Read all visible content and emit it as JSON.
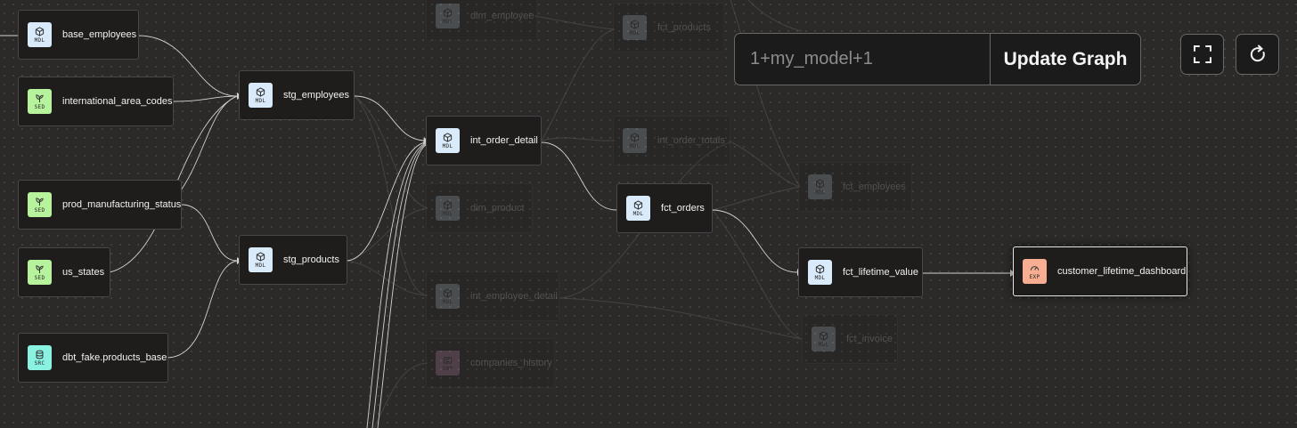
{
  "query": {
    "value": "1+my_model+1",
    "button_label": "Update Graph"
  },
  "toolbar": {
    "fullscreen_icon": "fullscreen-icon",
    "refresh_icon": "refresh-icon"
  },
  "colors": {
    "canvas": "#2b2a29",
    "node_bg": "#1e1d1c",
    "model_badge": "#d9ebfb",
    "seed_badge": "#b7f39d",
    "source_badge": "#89f2e1",
    "exposure_badge": "#f6ad92",
    "snapshot_badge": "#f19fd8"
  },
  "badge_tags": {
    "model": "MDL",
    "seed": "SED",
    "source": "SRC",
    "exposure": "EXP",
    "snapshot": "SNP"
  },
  "nodes": [
    {
      "label": "base_employees",
      "type": "model"
    },
    {
      "label": "international_area_codes",
      "type": "seed"
    },
    {
      "label": "prod_manufacturing_status",
      "type": "seed"
    },
    {
      "label": "us_states",
      "type": "seed"
    },
    {
      "label": "dbt_fake.products_base",
      "type": "source"
    },
    {
      "label": "stg_employees",
      "type": "model"
    },
    {
      "label": "stg_products",
      "type": "model"
    },
    {
      "label": "dim_employee",
      "type": "model"
    },
    {
      "label": "int_order_detail",
      "type": "model"
    },
    {
      "label": "dim_product",
      "type": "model"
    },
    {
      "label": "int_employee_detail",
      "type": "model"
    },
    {
      "label": "companies_history",
      "type": "snapshot"
    },
    {
      "label": "fct_products",
      "type": "model"
    },
    {
      "label": "int_order_totals",
      "type": "model"
    },
    {
      "label": "fct_orders",
      "type": "model"
    },
    {
      "label": "fct_employees",
      "type": "model"
    },
    {
      "label": "fct_lifetime_value",
      "type": "model"
    },
    {
      "label": "fct_invoice",
      "type": "model"
    },
    {
      "label": "customer_lifetime_dashboard",
      "type": "exposure"
    }
  ]
}
